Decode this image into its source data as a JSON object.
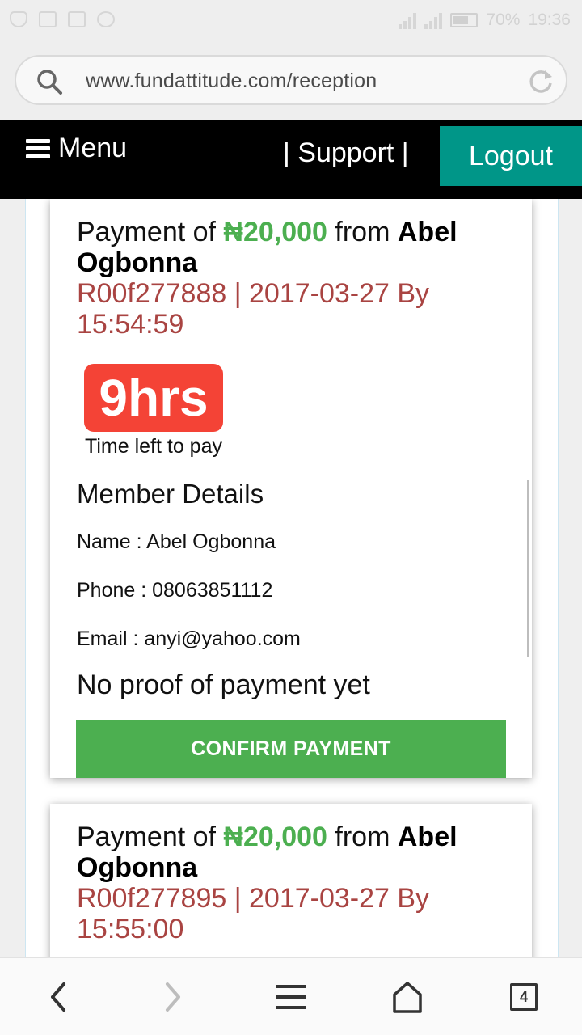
{
  "status_bar": {
    "battery": "70%",
    "time": "19:36"
  },
  "browser": {
    "url": "www.fundattitude.com/reception",
    "tab_count": "4"
  },
  "nav": {
    "menu_label": "Menu",
    "support_label": "| Support |",
    "logout_label": "Logout"
  },
  "payments": [
    {
      "prefix": "Payment of ",
      "amount": "₦20,000",
      "from": " from ",
      "name": "Abel Ogbonna",
      "ref": "R00f277888 | 2017-03-27 By 15:54:59",
      "timer": "9hrs",
      "timer_label": "Time left to pay",
      "section_title": "Member Details",
      "detail_name": "Name : Abel Ogbonna",
      "detail_phone": "Phone : 08063851112",
      "detail_email": "Email : anyi@yahoo.com",
      "proof_status": "No proof of payment yet",
      "confirm_label": "CONFIRM PAYMENT"
    },
    {
      "prefix": "Payment of ",
      "amount": "₦20,000",
      "from": " from ",
      "name": "Abel Ogbonna",
      "ref": "R00f277895 | 2017-03-27 By 15:55:00"
    }
  ],
  "colors": {
    "nav_bg": "#000000",
    "logout_bg": "#009688",
    "amount": "#4caf50",
    "ref": "#a94442",
    "timer_bg": "#f44336",
    "confirm_bg": "#4caf50"
  }
}
